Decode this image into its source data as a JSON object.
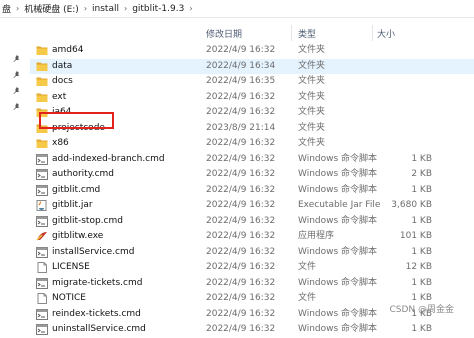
{
  "breadcrumb": [
    "盘",
    "机械硬盘 (E:)",
    "install",
    "gitblit-1.9.3"
  ],
  "columns": {
    "date": "修改日期",
    "type": "类型",
    "size": "大小"
  },
  "files": [
    {
      "name": "amd64",
      "date": "2022/4/9 16:32",
      "type": "文件夹",
      "size": "",
      "icon": "folder-icon"
    },
    {
      "name": "data",
      "date": "2022/4/9 16:34",
      "type": "文件夹",
      "size": "",
      "icon": "folder-icon"
    },
    {
      "name": "docs",
      "date": "2022/4/9 16:35",
      "type": "文件夹",
      "size": "",
      "icon": "folder-icon"
    },
    {
      "name": "ext",
      "date": "2022/4/9 16:32",
      "type": "文件夹",
      "size": "",
      "icon": "folder-icon"
    },
    {
      "name": "ia64",
      "date": "2022/4/9 16:32",
      "type": "文件夹",
      "size": "",
      "icon": "folder-icon"
    },
    {
      "name": "projectcode",
      "date": "2023/8/9 21:14",
      "type": "文件夹",
      "size": "",
      "icon": "folder-icon"
    },
    {
      "name": "x86",
      "date": "2022/4/9 16:32",
      "type": "文件夹",
      "size": "",
      "icon": "folder-icon"
    },
    {
      "name": "add-indexed-branch.cmd",
      "date": "2022/4/9 16:32",
      "type": "Windows 命令脚本",
      "size": "1 KB",
      "icon": "cmd-file-icon"
    },
    {
      "name": "authority.cmd",
      "date": "2022/4/9 16:32",
      "type": "Windows 命令脚本",
      "size": "2 KB",
      "icon": "cmd-file-icon"
    },
    {
      "name": "gitblit.cmd",
      "date": "2022/4/9 16:32",
      "type": "Windows 命令脚本",
      "size": "1 KB",
      "icon": "cmd-file-icon"
    },
    {
      "name": "gitblit.jar",
      "date": "2022/4/9 16:32",
      "type": "Executable Jar File",
      "size": "3,680 KB",
      "icon": "jar-file-icon"
    },
    {
      "name": "gitblit-stop.cmd",
      "date": "2022/4/9 16:32",
      "type": "Windows 命令脚本",
      "size": "1 KB",
      "icon": "cmd-file-icon"
    },
    {
      "name": "gitblitw.exe",
      "date": "2022/4/9 16:32",
      "type": "应用程序",
      "size": "101 KB",
      "icon": "exe-file-icon"
    },
    {
      "name": "installService.cmd",
      "date": "2022/4/9 16:32",
      "type": "Windows 命令脚本",
      "size": "1 KB",
      "icon": "cmd-file-icon"
    },
    {
      "name": "LICENSE",
      "date": "2022/4/9 16:32",
      "type": "文件",
      "size": "12 KB",
      "icon": "blank-file-icon"
    },
    {
      "name": "migrate-tickets.cmd",
      "date": "2022/4/9 16:32",
      "type": "Windows 命令脚本",
      "size": "1 KB",
      "icon": "cmd-file-icon"
    },
    {
      "name": "NOTICE",
      "date": "2022/4/9 16:32",
      "type": "文件",
      "size": "1 KB",
      "icon": "blank-file-icon"
    },
    {
      "name": "reindex-tickets.cmd",
      "date": "2022/4/9 16:32",
      "type": "Windows 命令脚本",
      "size": "1 KB",
      "icon": "cmd-file-icon"
    },
    {
      "name": "uninstallService.cmd",
      "date": "2022/4/9 16:32",
      "type": "Windows 命令脚本",
      "size": "1 KB",
      "icon": "cmd-file-icon"
    }
  ],
  "watermark": "CSDN @周金金",
  "colors": {
    "folder": "#f7c948",
    "folder_dark": "#e0a82e",
    "highlight": "#e2231a",
    "hover": "#e5f3ff"
  }
}
